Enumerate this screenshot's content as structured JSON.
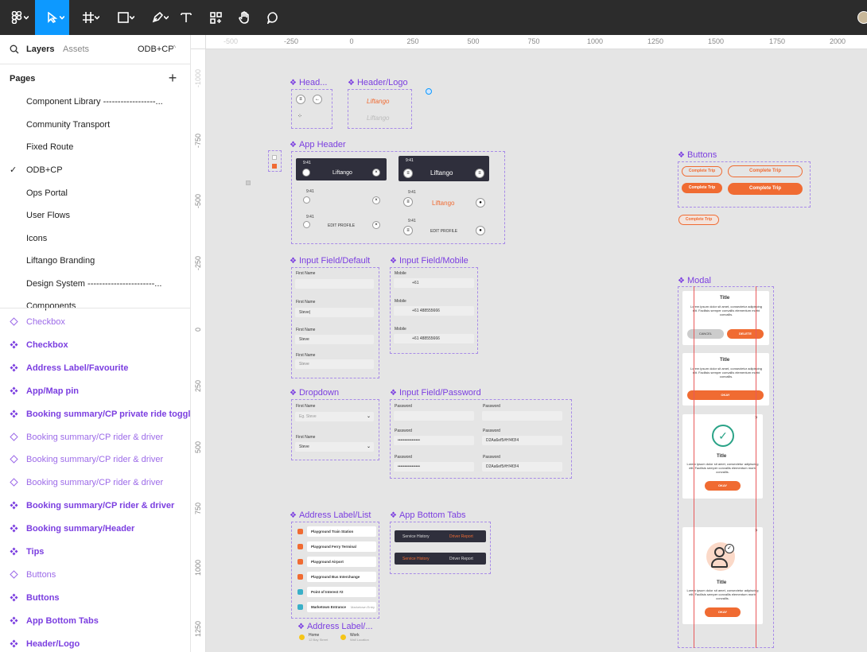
{
  "toolbar": {
    "tools": [
      "figma-menu",
      "move-tool",
      "frame-tool",
      "shape-tool",
      "pen-tool",
      "text-tool",
      "resources-tool",
      "hand-tool",
      "comment-tool"
    ]
  },
  "sidebar": {
    "tabs": {
      "layers": "Layers",
      "assets": "Assets"
    },
    "current_page_selector": "ODB+CP",
    "pages_heading": "Pages",
    "pages": [
      "Component Library ------------------...",
      "Community Transport",
      "Fixed Route",
      "ODB+CP",
      "Ops Portal",
      "User Flows",
      "Icons",
      "Liftango Branding",
      "Design System -----------------------...",
      "Components"
    ],
    "current_page_index": 3,
    "layers": [
      {
        "label": "Checkbox",
        "kind": "instance"
      },
      {
        "label": "Checkbox",
        "kind": "component"
      },
      {
        "label": "Address Label/Favourite",
        "kind": "component"
      },
      {
        "label": "App/Map pin",
        "kind": "component"
      },
      {
        "label": "Booking summary/CP private ride toggle",
        "kind": "component"
      },
      {
        "label": "Booking summary/CP rider & driver",
        "kind": "instance"
      },
      {
        "label": "Booking summary/CP rider & driver",
        "kind": "instance"
      },
      {
        "label": "Booking summary/CP rider & driver",
        "kind": "instance"
      },
      {
        "label": "Booking summary/CP rider & driver",
        "kind": "component"
      },
      {
        "label": "Booking summary/Header",
        "kind": "component"
      },
      {
        "label": "Tips",
        "kind": "component"
      },
      {
        "label": "Buttons",
        "kind": "instance"
      },
      {
        "label": "Buttons",
        "kind": "component"
      },
      {
        "label": "App Bottom Tabs",
        "kind": "component"
      },
      {
        "label": "Header/Logo",
        "kind": "component"
      }
    ]
  },
  "ruler": {
    "top": [
      "-500",
      "-250",
      "0",
      "250",
      "500",
      "750",
      "1000",
      "1250",
      "1500",
      "1750",
      "2000"
    ],
    "left": [
      "-1000",
      "-750",
      "-500",
      "-250",
      "0",
      "250",
      "500",
      "750",
      "1000",
      "1250"
    ]
  },
  "canvas": {
    "frames": {
      "head": "Head...",
      "header_logo": "Header/Logo",
      "app_header": "App Header",
      "buttons": "Buttons",
      "input_default": "Input Field/Default",
      "input_mobile": "Input Field/Mobile",
      "modal": "Modal",
      "dropdown": "Dropdown",
      "input_password": "Input Field/Password",
      "address_list": "Address Label/List",
      "bottom_tabs": "App Bottom Tabs",
      "address_label": "Address Label/..."
    },
    "brand": "Liftango",
    "time": "9:41",
    "edit_profile": "EDIT PROFILE",
    "labels": {
      "first_name": "First Name",
      "mobile": "Mobile",
      "password": "Password",
      "steve": "Steve",
      "steve_cursor": "Steve|",
      "placeholder_steve": "Eg. Steve",
      "code": "+61",
      "phone": "488555666",
      "pw_dots": "••••••••••••••••",
      "pw_plain": "D2Aa6ef5#H!4f3!4"
    },
    "buttons": {
      "complete_trip": "Complete Trip",
      "cancel": "CANCEL",
      "delete": "DELETE",
      "okay": "OKAY"
    },
    "modal": {
      "title": "Title",
      "body": "Lorem ipsum dolor sit amet, consectetur adipiscing elit. Facilisis semper convallis elementum morbi convallis."
    },
    "address_items": [
      "Playground Train Station",
      "Playground Ferry Terminal",
      "Playground Airport",
      "Playground Bus Interchange",
      "Point of Interest #2",
      "Marketown Entrance"
    ],
    "address_sub": "Marketown Entry",
    "fav": {
      "home": "Home",
      "home_sub": "12 Bay Street",
      "work": "Work",
      "work_sub": "Wall Location"
    },
    "tabs": {
      "service_history": "Service History",
      "driver_report": "Driver Report"
    },
    "colors": {
      "accent": "#f06b32",
      "purple": "#7b3ee0",
      "toolbar": "#2c2c2c",
      "selected": "#0d99ff"
    }
  }
}
